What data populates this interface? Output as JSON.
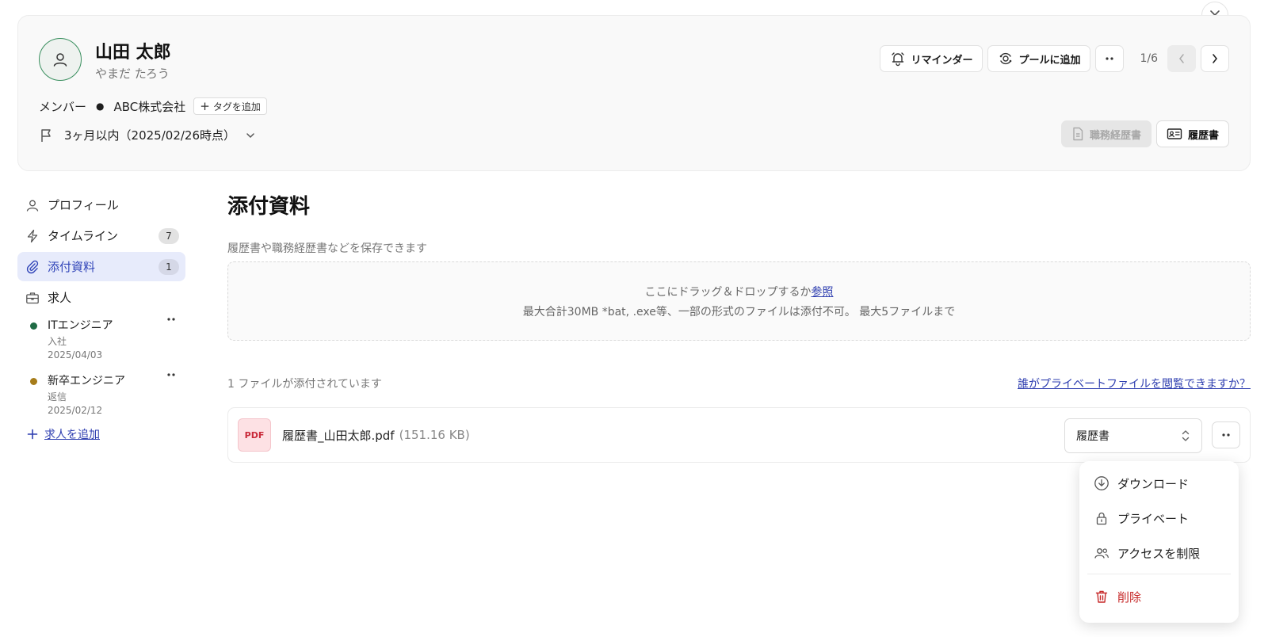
{
  "header": {
    "name": "山田 太郎",
    "kana": "やまだ たろう",
    "role": "メンバー",
    "company": "ABC株式会社",
    "add_tag_label": "タグを追加",
    "period": "3ヶ月以内（2025/02/26時点）",
    "reminder_label": "リマインダー",
    "add_pool_label": "プールに追加",
    "counter": "1/6",
    "resume_work_label": "職務経歴書",
    "resume_label": "履歴書"
  },
  "sidebar": {
    "items": [
      {
        "label": "プロフィール",
        "icon": "person-icon"
      },
      {
        "label": "タイムライン",
        "icon": "bolt-icon",
        "count": "7"
      },
      {
        "label": "添付資料",
        "icon": "paperclip-icon",
        "count": "1",
        "active": true
      },
      {
        "label": "求人",
        "icon": "briefcase-icon"
      }
    ],
    "jobs": [
      {
        "title": "ITエンジニア",
        "status": "入社",
        "date": "2025/04/03",
        "color": "#1f6b45"
      },
      {
        "title": "新卒エンジニア",
        "status": "返信",
        "date": "2025/02/12",
        "color": "#a67c1a"
      }
    ],
    "add_job_label": "求人を追加"
  },
  "main": {
    "title": "添付資料",
    "description": "履歴書や職務経歴書などを保存できます",
    "dropzone_text": "ここにドラッグ＆ドロップするか",
    "dropzone_link": "参照",
    "dropzone_note": "最大合計30MB *bat, .exe等、一部の形式のファイルは添付不可。 最大5ファイルまで",
    "files_count": "1 ファイルが添付されています",
    "private_link": "誰がプライベートファイルを閲覧できますか？",
    "file": {
      "badge": "PDF",
      "name": "履歴書_山田太郎.pdf",
      "size": "(151.16 KB)",
      "type": "履歴書"
    }
  },
  "menu": {
    "download": "ダウンロード",
    "private": "プライベート",
    "restrict": "アクセスを制限",
    "delete": "削除"
  },
  "colors": {
    "accent": "#2f3fb0",
    "active_bg": "#e7ebfb",
    "danger": "#c62828",
    "pdf_red": "#c92a3a"
  }
}
